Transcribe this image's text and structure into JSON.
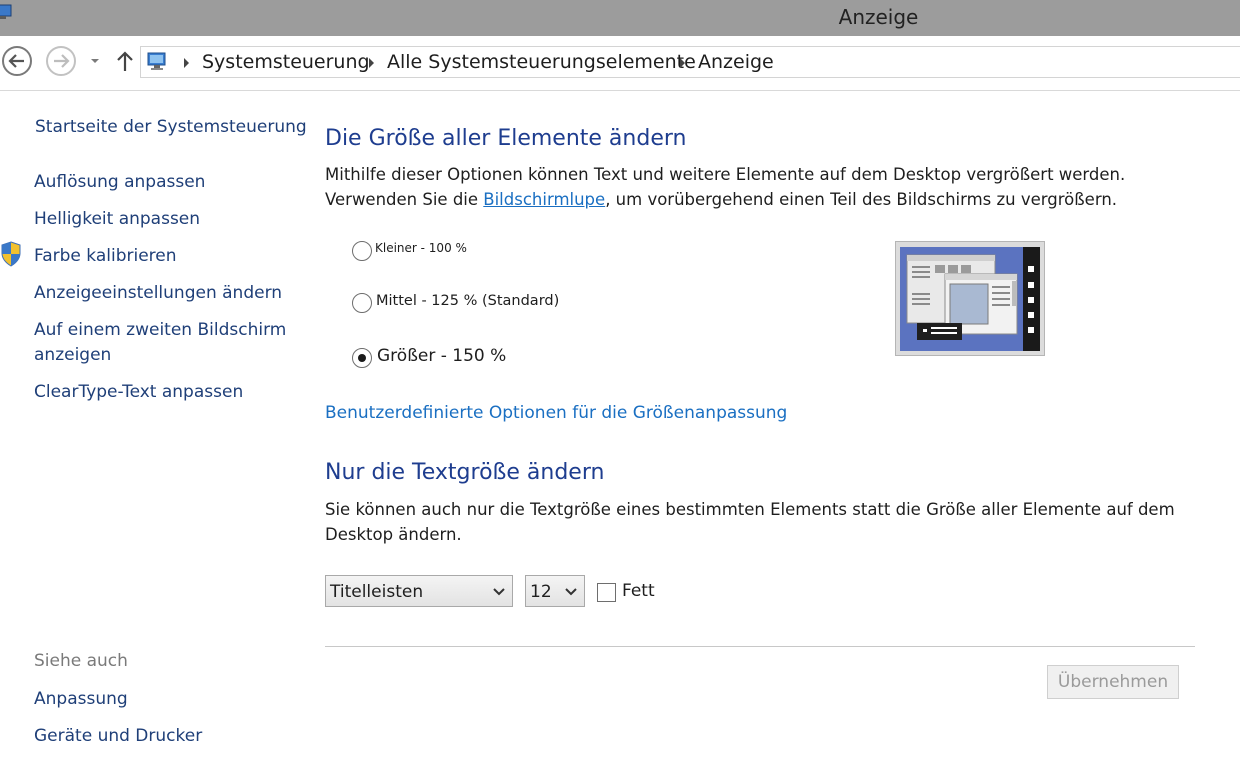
{
  "window": {
    "title": "Anzeige"
  },
  "address_bar": {
    "breadcrumbs": [
      "Systemsteuerung",
      "Alle Systemsteuerungselemente",
      "Anzeige"
    ]
  },
  "left_pane": {
    "home": "Startseite der Systemsteuerung",
    "items": [
      {
        "label": "Auflösung anpassen"
      },
      {
        "label": "Helligkeit anpassen"
      },
      {
        "label": "Farbe kalibrieren",
        "icon": "uac-shield-icon"
      },
      {
        "label": "Anzeigeeinstellungen ändern"
      },
      {
        "label": "Auf einem zweiten Bildschirm",
        "label2": "anzeigen"
      },
      {
        "label": "ClearType-Text anpassen"
      }
    ],
    "see_also_heading": "Siehe auch",
    "see_also": [
      "Anpassung",
      "Geräte und Drucker"
    ]
  },
  "main": {
    "size_section": {
      "heading": "Die Größe aller Elemente ändern",
      "desc_before_link": "Mithilfe dieser Optionen können Text und weitere Elemente auf dem Desktop vergrößert werden. Verwenden Sie die ",
      "desc_link": "Bildschirmlupe",
      "desc_after_link": ", um vorübergehend einen Teil des Bildschirms zu vergrößern.",
      "options": [
        {
          "label": "Kleiner - 100 %",
          "selected": false
        },
        {
          "label": "Mittel - 125 % (Standard)",
          "selected": false
        },
        {
          "label": "Größer - 150 %",
          "selected": true
        }
      ],
      "custom_link": "Benutzerdefinierte Optionen für die Größenanpassung"
    },
    "text_section": {
      "heading": "Nur die Textgröße ändern",
      "desc": "Sie können auch nur die Textgröße eines bestimmten Elements statt die Größe aller Elemente auf dem Desktop ändern.",
      "element_select": "Titelleisten",
      "size_select": "12",
      "bold_label": "Fett",
      "bold_checked": false
    },
    "apply_button": "Übernehmen"
  },
  "colors": {
    "title_bar": "#9c9c9c",
    "heading": "#1e3d8f",
    "link": "#1a6fc2",
    "nav_link": "#1f3f78"
  }
}
